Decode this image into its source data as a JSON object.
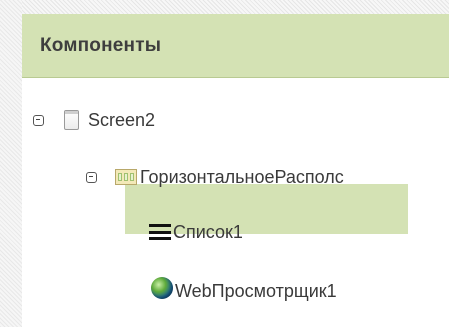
{
  "panel": {
    "title": "Компоненты"
  },
  "tree": {
    "screen": {
      "label": "Screen2",
      "icon": "screen-icon"
    },
    "arrangement": {
      "label": "ГоризонтальноеРасполс",
      "icon": "horizontal-arrangement-icon"
    },
    "list": {
      "label": "Список1",
      "icon": "list-icon"
    },
    "webviewer": {
      "label": "WebПросмотрщик1",
      "icon": "globe-icon",
      "selected": true
    }
  },
  "colors": {
    "header_bg": "#d4e2b4",
    "selection_bg": "#d4e2b4"
  }
}
